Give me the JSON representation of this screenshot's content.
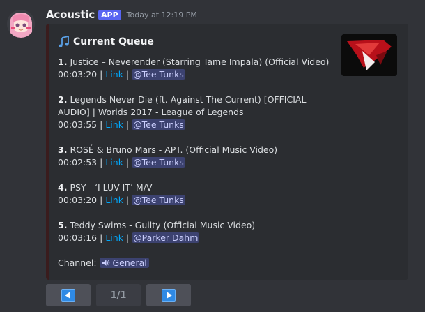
{
  "message": {
    "username": "Acoustic",
    "badge": "APP",
    "timestamp": "Today at 12:19 PM"
  },
  "embed": {
    "title": "Current Queue",
    "title_icon": "music-note-icon",
    "accent_color": "#3a1c1d",
    "tracks": [
      {
        "num": "1.",
        "title": "Justice – Neverender (Starring Tame Impala) (Official Video)",
        "duration": "00:03:20",
        "link": "Link",
        "requester": "@Tee Tunks"
      },
      {
        "num": "2.",
        "title": "Legends Never Die (ft. Against The Current) [OFFICIAL AUDIO] | Worlds 2017 - League of Legends",
        "duration": "00:03:55",
        "link": "Link",
        "requester": "@Tee Tunks"
      },
      {
        "num": "3.",
        "title": "ROSÉ & Bruno Mars - APT. (Official Music Video)",
        "duration": "00:02:53",
        "link": "Link",
        "requester": "@Tee Tunks"
      },
      {
        "num": "4.",
        "title": "PSY - ‘I LUV IT’ M/V",
        "duration": "00:03:20",
        "link": "Link",
        "requester": "@Tee Tunks"
      },
      {
        "num": "5.",
        "title": "Teddy Swims - Guilty (Official Music Video)",
        "duration": "00:03:16",
        "link": "Link",
        "requester": "@Parker Dahm"
      }
    ],
    "separator": "|",
    "channel_label": "Channel:",
    "channel_name": "General",
    "channel_icon": "speaker-icon"
  },
  "buttons": {
    "prev_icon": "left-arrow-icon",
    "page": "1/1",
    "next_icon": "right-arrow-icon"
  }
}
